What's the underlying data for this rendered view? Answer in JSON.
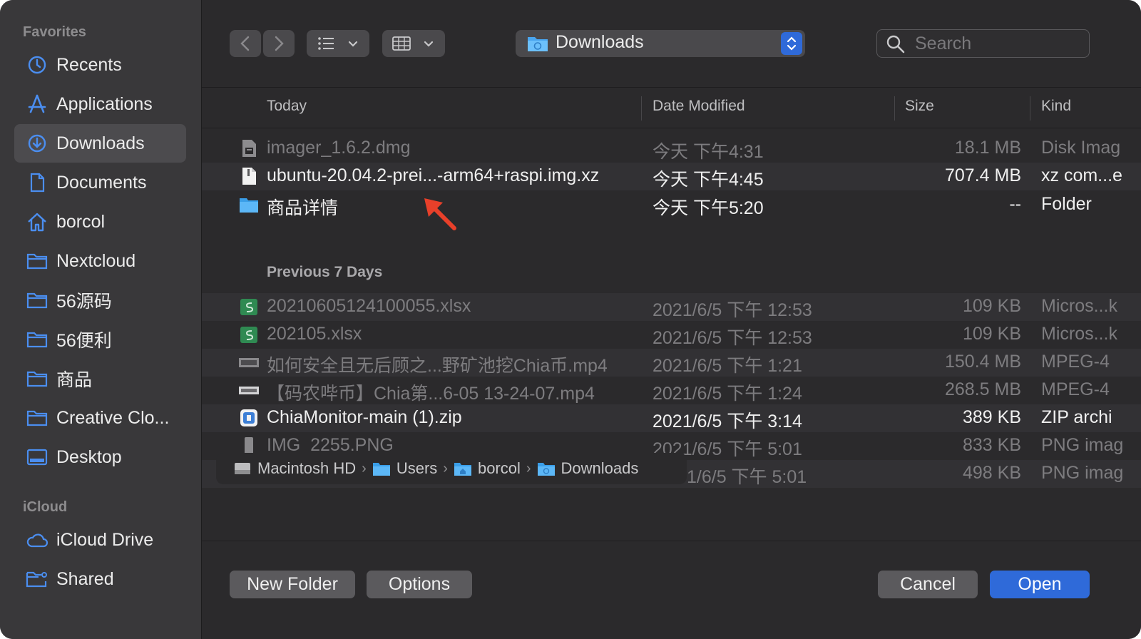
{
  "sidebar": {
    "favorites_label": "Favorites",
    "items": [
      {
        "label": "Recents",
        "icon": "clock-icon"
      },
      {
        "label": "Applications",
        "icon": "applications-icon"
      },
      {
        "label": "Downloads",
        "icon": "download-icon",
        "selected": true
      },
      {
        "label": "Documents",
        "icon": "document-icon"
      },
      {
        "label": "borcol",
        "icon": "home-icon"
      },
      {
        "label": "Nextcloud",
        "icon": "folder-icon"
      },
      {
        "label": "56源码",
        "icon": "folder-icon"
      },
      {
        "label": "56便利",
        "icon": "folder-icon"
      },
      {
        "label": "商品",
        "icon": "folder-icon"
      },
      {
        "label": "Creative Clo...",
        "icon": "folder-icon"
      },
      {
        "label": "Desktop",
        "icon": "desktop-icon"
      }
    ],
    "icloud_label": "iCloud",
    "icloud_items": [
      {
        "label": "iCloud Drive",
        "icon": "cloud-icon"
      },
      {
        "label": "Shared",
        "icon": "shared-folder-icon"
      }
    ]
  },
  "toolbar": {
    "location": "Downloads",
    "search_placeholder": "Search"
  },
  "columns": {
    "name": "Today",
    "date": "Date Modified",
    "size": "Size",
    "kind": "Kind"
  },
  "today_files": [
    {
      "name": "imager_1.6.2.dmg",
      "date": "今天 下午4:31",
      "size": "18.1 MB",
      "kind": "Disk Imag",
      "icon": "disk-image-icon"
    },
    {
      "name": "ubuntu-20.04.2-prei...-arm64+raspi.img.xz",
      "date": "今天 下午4:45",
      "size": "707.4 MB",
      "kind": "xz com...e",
      "icon": "document-icon"
    },
    {
      "name": "商品详情",
      "date": "今天 下午5:20",
      "size": "--",
      "kind": "Folder",
      "icon": "folder-icon"
    }
  ],
  "group_previous": "Previous 7 Days",
  "previous_files": [
    {
      "name": "20210605124100055.xlsx",
      "date": "2021/6/5 下午 12:53",
      "size": "109 KB",
      "kind": "Micros...k",
      "icon": "spreadsheet-icon"
    },
    {
      "name": "202105.xlsx",
      "date": "2021/6/5 下午 12:53",
      "size": "109 KB",
      "kind": "Micros...k",
      "icon": "spreadsheet-icon"
    },
    {
      "name": "如何安全且无后顾之...野矿池挖Chia币.mp4",
      "date": "2021/6/5 下午 1:21",
      "size": "150.4 MB",
      "kind": "MPEG-4",
      "icon": "video-icon"
    },
    {
      "name": "【码农哔币】Chia第...6-05 13-24-07.mp4",
      "date": "2021/6/5 下午 1:24",
      "size": "268.5 MB",
      "kind": "MPEG-4",
      "icon": "video-icon"
    },
    {
      "name": "ChiaMonitor-main (1).zip",
      "date": "2021/6/5 下午 3:14",
      "size": "389 KB",
      "kind": "ZIP archi",
      "icon": "zip-icon"
    },
    {
      "name": "IMG_2255.PNG",
      "date": "2021/6/5 下午 5:01",
      "size": "833 KB",
      "kind": "PNG imag",
      "icon": "image-icon"
    },
    {
      "name": "",
      "date": "1/6/5 下午 5:01",
      "size": "498 KB",
      "kind": "PNG imag",
      "icon": "image-icon"
    }
  ],
  "path": [
    "Macintosh HD",
    "Users",
    "borcol",
    "Downloads"
  ],
  "buttons": {
    "new_folder": "New Folder",
    "options": "Options",
    "cancel": "Cancel",
    "open": "Open"
  },
  "colors": {
    "accent": "#2f6ad9",
    "annotation_arrow": "#e8402a"
  }
}
